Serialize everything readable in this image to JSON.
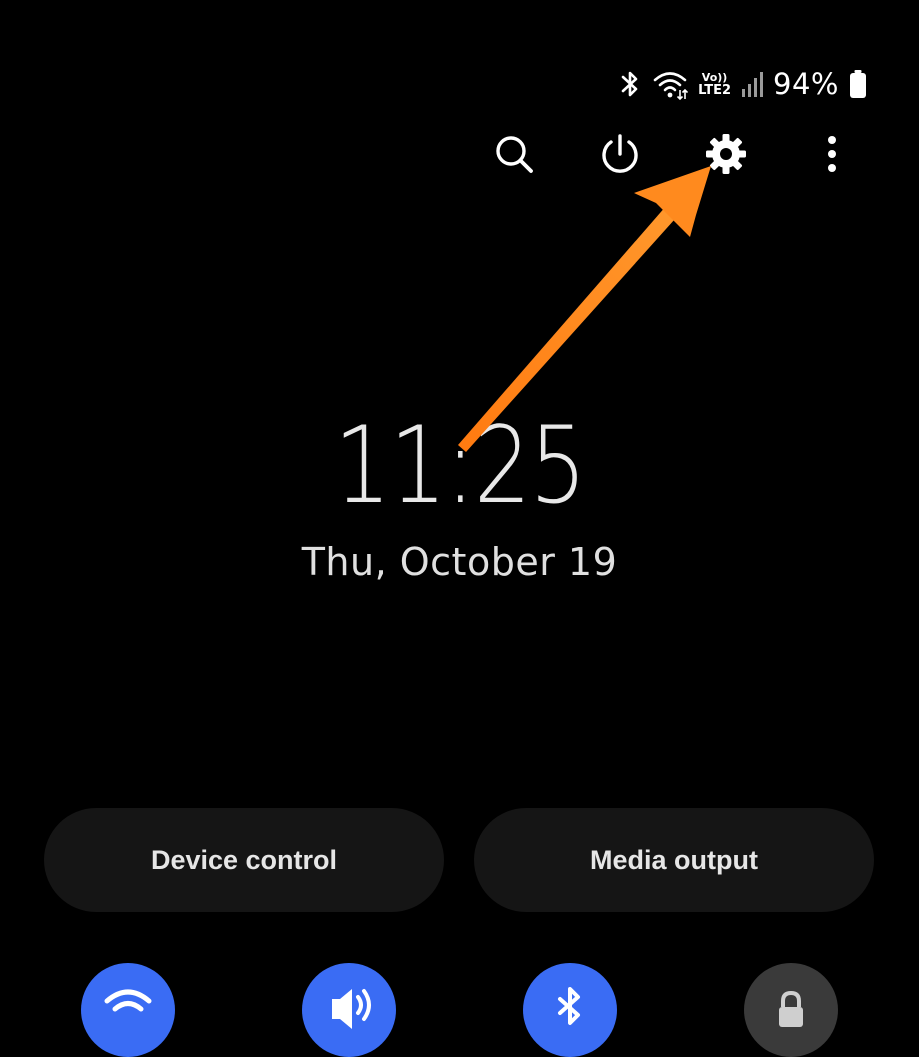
{
  "status_bar": {
    "battery_percent": "94%",
    "network_top": "Vo))",
    "network_bottom": "LTE2",
    "icons": [
      "bluetooth-icon",
      "wifi-icon",
      "volte-lte-icon",
      "signal-icon",
      "battery-icon"
    ]
  },
  "toolbar": {
    "icons": [
      "search-icon",
      "power-icon",
      "gear-icon",
      "more-vert-icon"
    ]
  },
  "clock": {
    "time": "11:25",
    "date": "Thu, October 19"
  },
  "buttons": {
    "device_control": "Device control",
    "media_output": "Media output"
  },
  "quick_tiles": [
    {
      "name": "wifi",
      "icon": "wifi-icon",
      "state": "on"
    },
    {
      "name": "sound",
      "icon": "volume-icon",
      "state": "on"
    },
    {
      "name": "bluetooth",
      "icon": "bluetooth-icon",
      "state": "on"
    },
    {
      "name": "rotation-lock",
      "icon": "lock-icon",
      "state": "off"
    }
  ],
  "colors": {
    "background": "#000000",
    "accent_blue": "#3a6cf4",
    "tile_off": "#3a3a3a",
    "annotation_arrow": "#ff8a1e",
    "pill_background": "#151515"
  }
}
